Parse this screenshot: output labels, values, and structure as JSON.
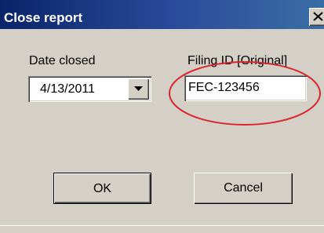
{
  "window": {
    "title": "Close report",
    "close_glyph": "X"
  },
  "form": {
    "date_closed_label": "Date closed",
    "date_closed_value": "4/13/2011",
    "filing_id_label": "Filing ID [Original]",
    "filing_id_value": "FEC-123456"
  },
  "buttons": {
    "ok_label": "OK",
    "cancel_label": "Cancel"
  },
  "annotation": {
    "highlight_color": "#d9252a"
  },
  "colors": {
    "titlebar_start": "#0a246a",
    "titlebar_end": "#3a6ea5",
    "dialog_face": "#d4d0c8"
  }
}
